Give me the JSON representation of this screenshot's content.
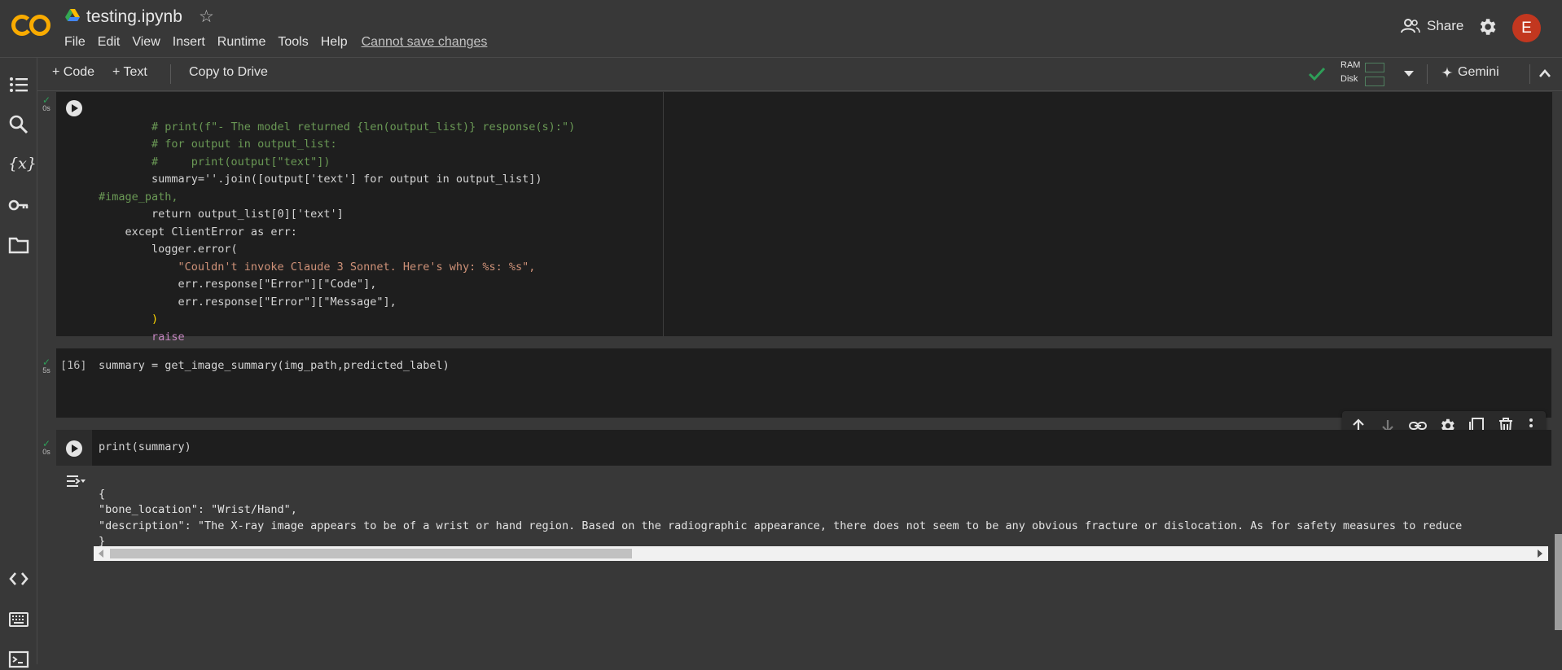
{
  "header": {
    "filename": "testing.ipynb",
    "menu": [
      "File",
      "Edit",
      "View",
      "Insert",
      "Runtime",
      "Tools",
      "Help"
    ],
    "save_warning": "Cannot save changes",
    "share_label": "Share",
    "avatar_initial": "E"
  },
  "toolbar": {
    "add_code": "+ Code",
    "add_text": "+ Text",
    "copy_to_drive": "Copy to Drive",
    "ram_label": "RAM",
    "disk_label": "Disk",
    "gemini_label": "Gemini"
  },
  "cells": [
    {
      "status_time": "0s",
      "code_lines": [
        "        # print(f\"- The model returned {len(output_list)} response(s):\")",
        "        # for output in output_list:",
        "        #     print(output[\"text\"])",
        "        summary=''.join([output['text'] for output in output_list])",
        "#image_path,",
        "        return output_list[0]['text']",
        "    except ClientError as err:",
        "        logger.error(",
        "            \"Couldn't invoke Claude 3 Sonnet. Here's why: %s: %s\",",
        "            err.response[\"Error\"][\"Code\"],",
        "            err.response[\"Error\"][\"Message\"],",
        "        )",
        "        raise"
      ]
    },
    {
      "status_time": "5s",
      "exec_count": "[16]",
      "code": "summary = get_image_summary(img_path,predicted_label)"
    },
    {
      "status_time": "0s",
      "code": "print(summary)",
      "output_lines": [
        "{",
        "\"bone_location\": \"Wrist/Hand\",",
        "\"description\": \"The X-ray image appears to be of a wrist or hand region. Based on the radiographic appearance, there does not seem to be any obvious fracture or dislocation. As for safety measures to reduce",
        "}"
      ]
    }
  ],
  "colors": {
    "accent_orange": "#f9ab00",
    "avatar_bg": "#c2371f",
    "check_green": "#2e9e58"
  },
  "icons": {
    "sidebar": [
      "table-of-contents-icon",
      "search-icon",
      "variables-icon",
      "key-icon",
      "folder-icon",
      "code-snippets-icon",
      "command-palette-icon",
      "terminal-icon"
    ],
    "cell_actions": [
      "move-up-icon",
      "move-down-icon",
      "link-icon",
      "settings-icon",
      "mirror-cell-icon",
      "delete-icon",
      "more-vert-icon"
    ]
  }
}
